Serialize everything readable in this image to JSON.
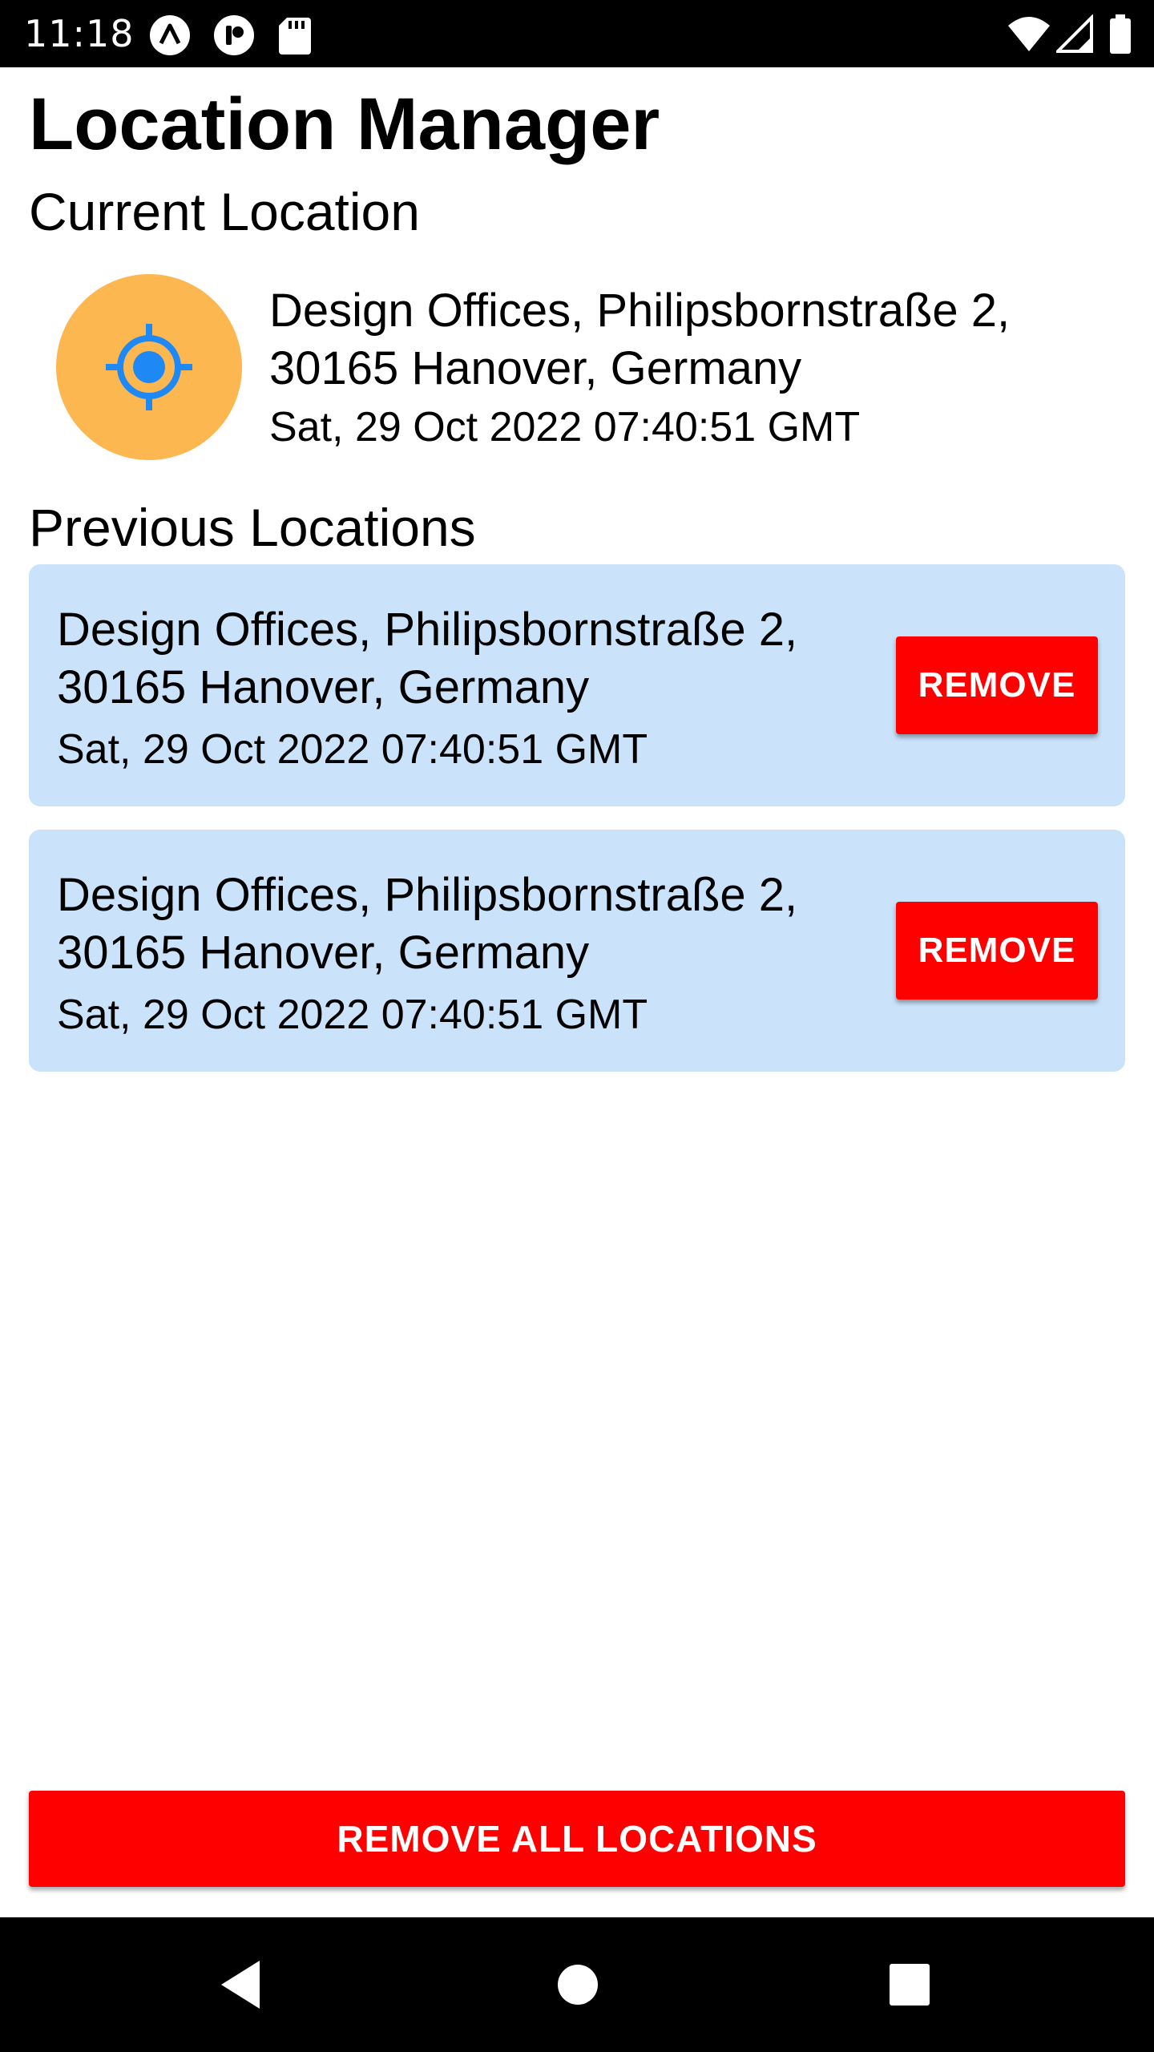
{
  "status_bar": {
    "time": "11:18",
    "left_icons": [
      "expo-icon",
      "recorder-icon",
      "sd-card-icon"
    ],
    "right_icons": [
      "wifi-icon",
      "signal-icon",
      "battery-icon"
    ]
  },
  "app": {
    "title": "Location Manager",
    "current_section_label": "Current Location",
    "current": {
      "icon": "location-crosshair-icon",
      "address": "Design Offices, Philipsbornstraße 2, 30165 Hanover, Germany",
      "timestamp": "Sat, 29 Oct 2022 07:40:51 GMT"
    },
    "previous_section_label": "Previous Locations",
    "previous": [
      {
        "address": "Design Offices, Philipsbornstraße 2, 30165 Hanover, Germany",
        "timestamp": "Sat, 29 Oct 2022 07:40:51 GMT",
        "remove_label": "REMOVE"
      },
      {
        "address": "Design Offices, Philipsbornstraße 2, 30165 Hanover, Germany",
        "timestamp": "Sat, 29 Oct 2022 07:40:51 GMT",
        "remove_label": "REMOVE"
      }
    ],
    "remove_all_label": "REMOVE ALL LOCATIONS"
  },
  "nav_bar": {
    "icons": [
      "back-icon",
      "home-icon",
      "recents-icon"
    ]
  },
  "colors": {
    "accent_red": "#FF0000",
    "card_blue": "#CAE3FB",
    "icon_circle": "#FDB750",
    "icon_blue": "#1E88F5"
  }
}
